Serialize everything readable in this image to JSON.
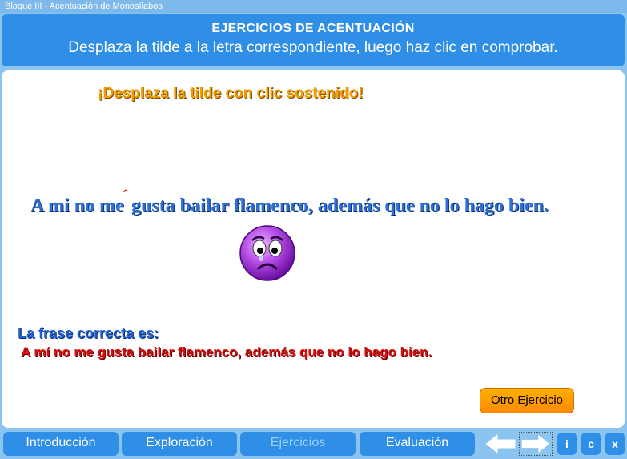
{
  "window": {
    "title": "Bloque III - Acentuación de Monosílabos"
  },
  "header": {
    "title": "EJERCICIOS DE ACENTUACIÓN",
    "subtitle": "Desplaza la tilde a la letra correspondiente, luego haz clic en comprobar."
  },
  "exercise": {
    "instruction": "¡Desplaza la tilde con clic sostenido!",
    "sentence_before": "A mi no me",
    "tilde_mark": "´",
    "sentence_after": "gusta bailar flamenco, además que no lo hago bien.",
    "feedback_face": "sad-face-icon",
    "correct_label": "La frase correcta es:",
    "correct_sentence": "A mí no me gusta bailar flamenco, además que no lo hago bien.",
    "otro_button": "Otro Ejercicio"
  },
  "nav": {
    "tabs": [
      {
        "label": "Introducción"
      },
      {
        "label": "Exploración"
      },
      {
        "label": "Ejercicios"
      },
      {
        "label": "Evaluación"
      }
    ],
    "prev_icon": "arrow-left-icon",
    "next_icon": "arrow-right-icon",
    "info": "i",
    "credits": "c",
    "close": "x"
  },
  "colors": {
    "accent": "#2f8ee6",
    "instruction": "#f39c00",
    "sentence": "#2e6fd8",
    "correct_text": "#d90f0f"
  }
}
